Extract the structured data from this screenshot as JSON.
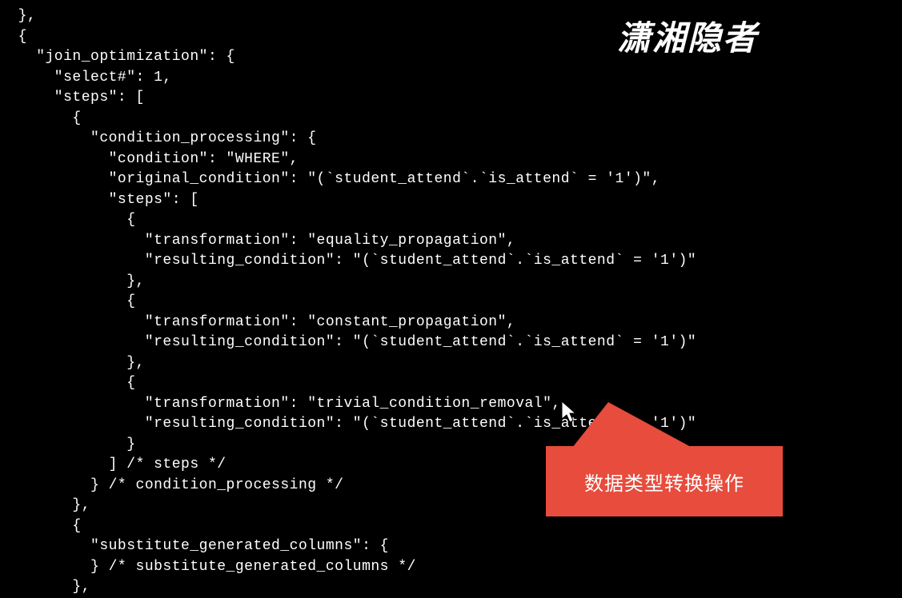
{
  "watermark": "潇湘隐者",
  "callout": {
    "text": "数据类型转换操作"
  },
  "code": {
    "lines": [
      "  },",
      "  {",
      "    \"join_optimization\": {",
      "      \"select#\": 1,",
      "      \"steps\": [",
      "        {",
      "          \"condition_processing\": {",
      "            \"condition\": \"WHERE\",",
      "            \"original_condition\": \"(`student_attend`.`is_attend` = '1')\",",
      "            \"steps\": [",
      "              {",
      "                \"transformation\": \"equality_propagation\",",
      "                \"resulting_condition\": \"(`student_attend`.`is_attend` = '1')\"",
      "              },",
      "              {",
      "                \"transformation\": \"constant_propagation\",",
      "                \"resulting_condition\": \"(`student_attend`.`is_attend` = '1')\"",
      "              },",
      "              {",
      "                \"transformation\": \"trivial_condition_removal\",",
      "                \"resulting_condition\": \"(`student_attend`.`is_attend` = '1')\"",
      "              }",
      "            ] /* steps */",
      "          } /* condition_processing */",
      "        },",
      "        {",
      "          \"substitute_generated_columns\": {",
      "          } /* substitute_generated_columns */",
      "        },"
    ]
  }
}
